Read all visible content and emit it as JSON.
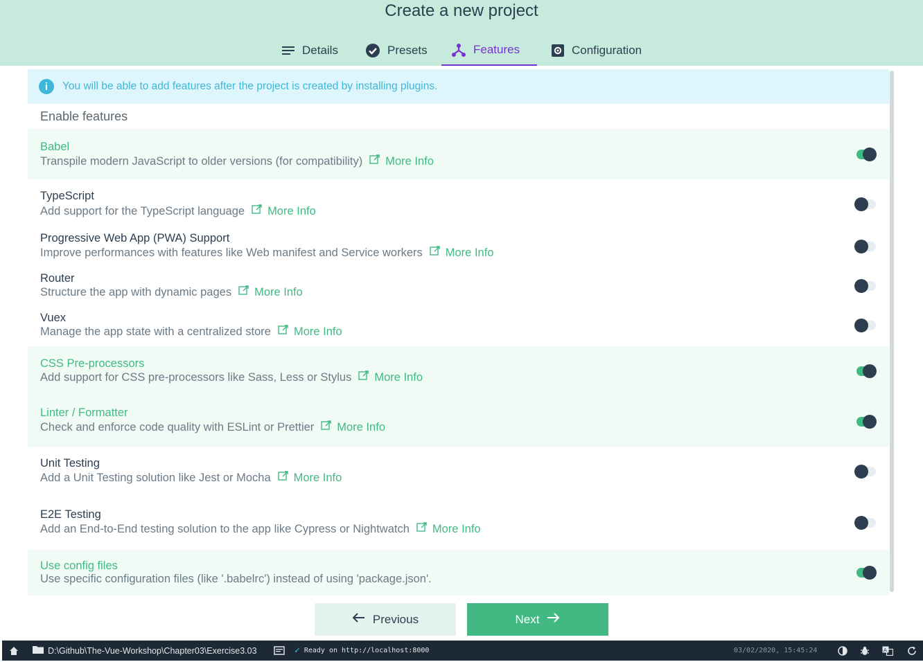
{
  "header": {
    "title": "Create a new project",
    "tabs": [
      {
        "label": "Details",
        "icon": "list-icon",
        "active": false
      },
      {
        "label": "Presets",
        "icon": "check-circle-icon",
        "active": false
      },
      {
        "label": "Features",
        "icon": "tree-icon",
        "active": true
      },
      {
        "label": "Configuration",
        "icon": "settings-box-icon",
        "active": false
      }
    ]
  },
  "info": {
    "icon": "info-icon",
    "text": "You will be able to add features after the project is created by installing plugins."
  },
  "section_title": "Enable features",
  "more_info_label": "More Info",
  "features": [
    {
      "name": "Babel",
      "description": "Transpile modern JavaScript to older versions (for compatibility)",
      "more_info": true,
      "enabled": true
    },
    {
      "name": "TypeScript",
      "description": "Add support for the TypeScript language",
      "more_info": true,
      "enabled": false
    },
    {
      "name": "Progressive Web App (PWA) Support",
      "description": "Improve performances with features like Web manifest and Service workers",
      "more_info": true,
      "enabled": false
    },
    {
      "name": "Router",
      "description": "Structure the app with dynamic pages",
      "more_info": true,
      "enabled": false
    },
    {
      "name": "Vuex",
      "description": "Manage the app state with a centralized store",
      "more_info": true,
      "enabled": false
    },
    {
      "name": "CSS Pre-processors",
      "description": "Add support for CSS pre-processors like Sass, Less or Stylus",
      "more_info": true,
      "enabled": true
    },
    {
      "name": "Linter / Formatter",
      "description": "Check and enforce code quality with ESLint or Prettier",
      "more_info": true,
      "enabled": true
    },
    {
      "name": "Unit Testing",
      "description": "Add a Unit Testing solution like Jest or Mocha",
      "more_info": true,
      "enabled": false
    },
    {
      "name": "E2E Testing",
      "description": "Add an End-to-End testing solution to the app like Cypress or Nightwatch",
      "more_info": true,
      "enabled": false
    },
    {
      "name": "Use config files",
      "description": "Use specific configuration files (like '.babelrc') instead of using 'package.json'.",
      "more_info": false,
      "enabled": true
    }
  ],
  "buttons": {
    "previous_label": "Previous",
    "next_label": "Next"
  },
  "statusbar": {
    "path": "D:\\Github\\The-Vue-Workshop\\Chapter03\\Exercise3.03",
    "status": "Ready on http://localhost:8000",
    "datetime": "03/02/2020, 15:45:24"
  },
  "colors": {
    "accent": "#42b983",
    "header_bg": "#c6ebdc",
    "active_tab": "#7533d0",
    "info": "#3fb7d8",
    "statusbar_bg": "#1d2935"
  }
}
